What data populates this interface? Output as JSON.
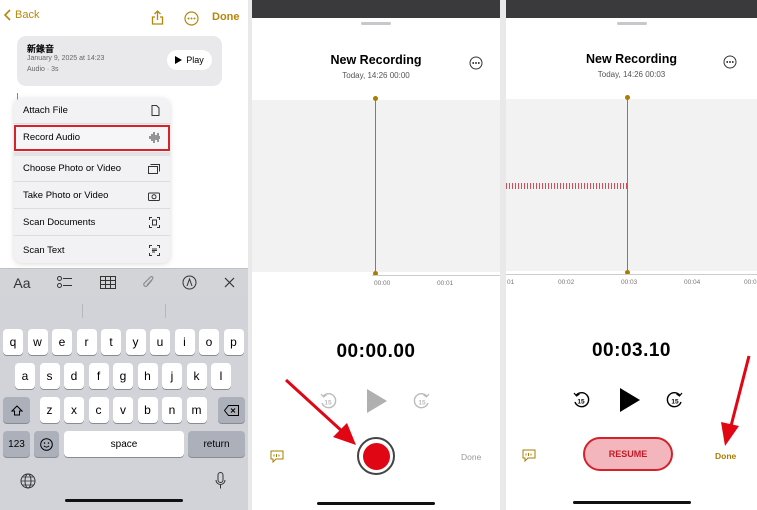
{
  "notes": {
    "back_label": "Back",
    "done_label": "Done",
    "attachment": {
      "title": "新錄音",
      "date": "January 9, 2025 at 14:23",
      "subtitle": "Audio · 3s",
      "play_label": "Play"
    },
    "menu": [
      {
        "label": "Attach File",
        "icon": "doc-icon"
      },
      {
        "label": "Record Audio",
        "icon": "waveform-icon"
      },
      {
        "label": "Choose Photo or Video",
        "icon": "photo-icon"
      },
      {
        "label": "Take Photo or Video",
        "icon": "camera-icon"
      },
      {
        "label": "Scan Documents",
        "icon": "scan-doc-icon"
      },
      {
        "label": "Scan Text",
        "icon": "scan-text-icon"
      }
    ],
    "format_bar": {
      "text_style_label": "Aa"
    },
    "keyboard": {
      "row1": [
        "q",
        "w",
        "e",
        "r",
        "t",
        "y",
        "u",
        "i",
        "o",
        "p"
      ],
      "row2": [
        "a",
        "s",
        "d",
        "f",
        "g",
        "h",
        "j",
        "k",
        "l"
      ],
      "row3": [
        "z",
        "x",
        "c",
        "v",
        "b",
        "n",
        "m"
      ],
      "numbers_label": "123",
      "space_label": "space",
      "return_label": "return"
    }
  },
  "recording_initial": {
    "title": "New Recording",
    "subtitle": "Today, 14:26   00:00",
    "ruler": [
      "00:00",
      "00:01"
    ],
    "timer": "00:00.00",
    "done_label": "Done"
  },
  "recording_paused": {
    "title": "New Recording",
    "subtitle": "Today, 14:26   00:03",
    "ruler": [
      "01",
      "00:02",
      "00:03",
      "00:04",
      "00:0"
    ],
    "timer": "00:03.10",
    "resume_label": "RESUME",
    "done_label": "Done"
  },
  "colors": {
    "accent": "#b8860b",
    "record": "#e00613",
    "highlight": "#d6232a",
    "arrow": "#e00613"
  }
}
